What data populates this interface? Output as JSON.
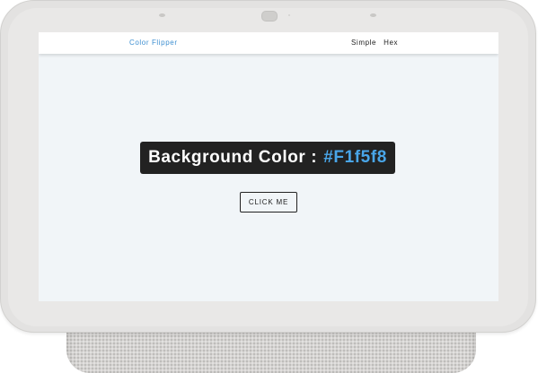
{
  "navbar": {
    "brand": "Color Flipper",
    "links": [
      {
        "label": "Simple"
      },
      {
        "label": "Hex"
      }
    ]
  },
  "main": {
    "label": "Background Color :",
    "color_value": "#F1f5f8",
    "button_label": "CLICK ME"
  },
  "colors": {
    "screen_background": "#f1f5f8",
    "accent": "#49a6e9",
    "brand": "#3d8fd1",
    "dark": "#222222",
    "device_frame": "#e3e2e1"
  }
}
